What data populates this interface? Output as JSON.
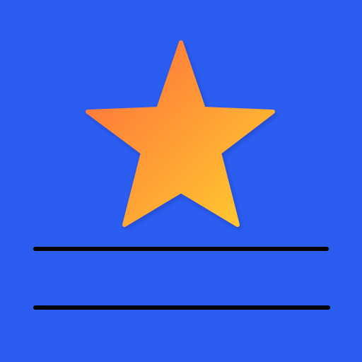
{
  "background": {
    "color": "#2B5DF1"
  },
  "star": {
    "icon": "star-icon",
    "gradient": {
      "start": "#FF6A3D",
      "end": "#FFD02E"
    },
    "shadow": "#1a2f7a"
  },
  "lines": {
    "color": "#000000",
    "count": 2
  }
}
